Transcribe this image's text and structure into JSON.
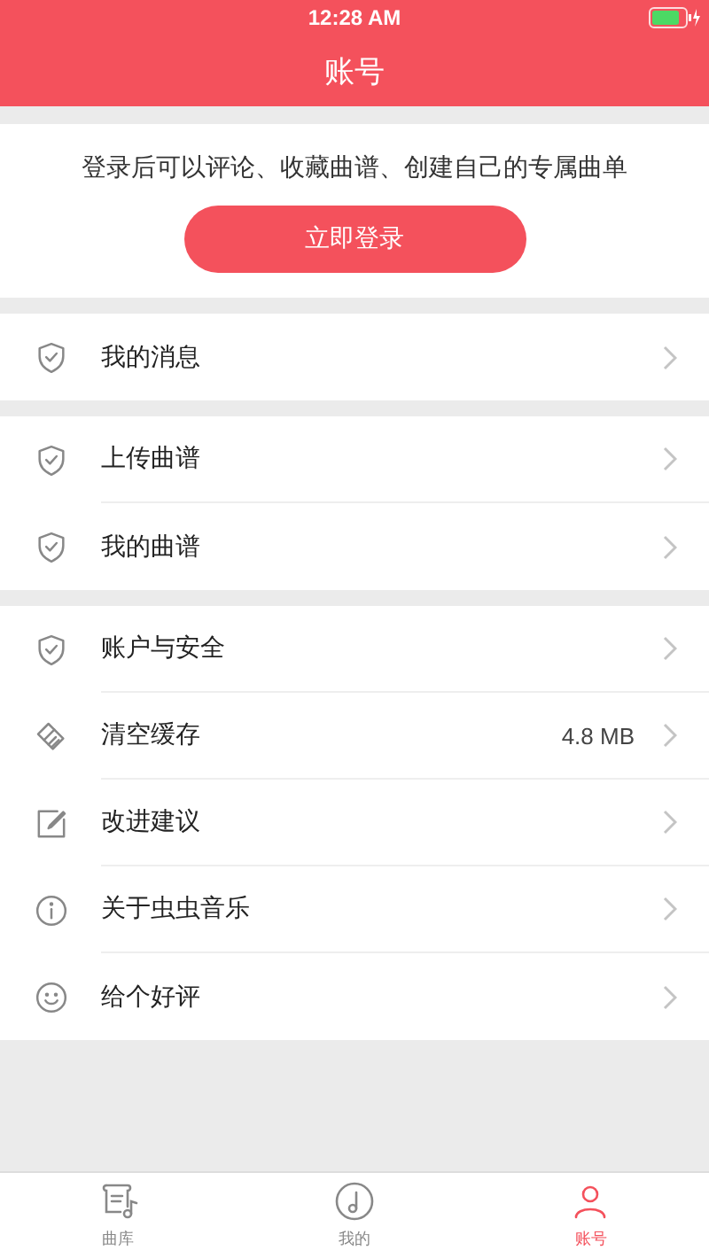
{
  "status_bar": {
    "time": "12:28 AM"
  },
  "nav": {
    "title": "账号"
  },
  "login": {
    "prompt": "登录后可以评论、收藏曲谱、创建自己的专属曲单",
    "button": "立即登录"
  },
  "groups": [
    {
      "items": [
        {
          "kind": "shield",
          "label": "我的消息"
        }
      ]
    },
    {
      "items": [
        {
          "kind": "shield",
          "label": "上传曲谱"
        },
        {
          "kind": "shield",
          "label": "我的曲谱"
        }
      ]
    },
    {
      "items": [
        {
          "kind": "shield",
          "label": "账户与安全"
        },
        {
          "kind": "broom",
          "label": "清空缓存",
          "value": "4.8 MB"
        },
        {
          "kind": "edit",
          "label": "改进建议"
        },
        {
          "kind": "info",
          "label": "关于虫虫音乐"
        },
        {
          "kind": "smile",
          "label": "给个好评"
        }
      ]
    }
  ],
  "tabs": [
    {
      "kind": "score",
      "label": "曲库",
      "selected": false
    },
    {
      "kind": "note",
      "label": "我的",
      "selected": false
    },
    {
      "kind": "person",
      "label": "账号",
      "selected": true
    }
  ]
}
